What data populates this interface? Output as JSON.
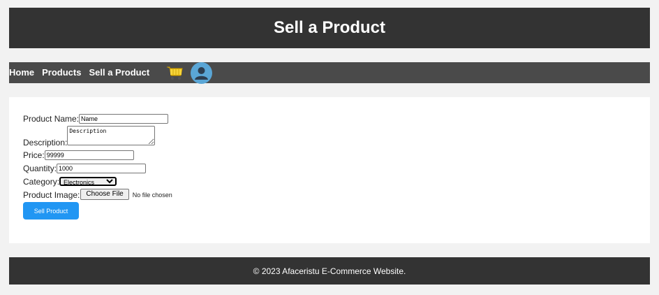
{
  "header": {
    "title": "Sell a Product"
  },
  "nav": {
    "links": [
      "Home",
      "Products",
      "Sell a Product"
    ],
    "cart_icon": "shopping-cart-icon",
    "user_icon": "user-avatar-icon",
    "colors": {
      "bar": "#4a4a4a",
      "text": "#ffffff"
    }
  },
  "form": {
    "name_label": "Product Name:",
    "name_value": "Name",
    "description_label": "Description:",
    "description_value": "Description",
    "price_label": "Price:",
    "price_value": "99999",
    "quantity_label": "Quantity:",
    "quantity_value": "1000",
    "category_label": "Category:",
    "category_selected": "Electronics",
    "image_label": "Product Image:",
    "choose_file_label": "Choose File",
    "no_file_text": "No file chosen",
    "submit_label": "Sell Product"
  },
  "footer": {
    "text": "© 2023 Afaceristu E-Commerce Website."
  },
  "colors": {
    "header_bg": "#333333",
    "page_bg": "#f2f2f2",
    "accent": "#2196f3"
  }
}
